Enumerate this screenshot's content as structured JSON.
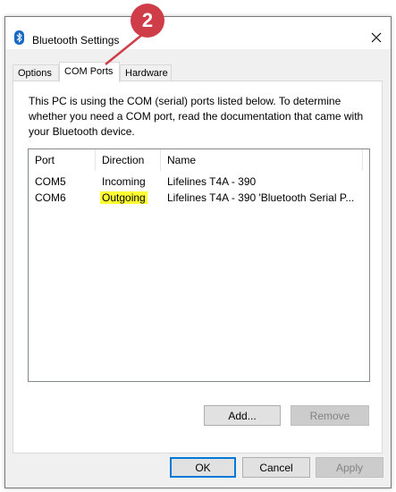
{
  "window": {
    "title": "Bluetooth Settings",
    "icon": "bluetooth-icon",
    "close_icon": "close-icon"
  },
  "tabs": [
    {
      "label": "Options",
      "active": false
    },
    {
      "label": "COM Ports",
      "active": true
    },
    {
      "label": "Hardware",
      "active": false
    }
  ],
  "panel": {
    "description": "This PC is using the COM (serial) ports listed below. To determine whether you need a COM port, read the documentation that came with your Bluetooth device."
  },
  "list": {
    "columns": [
      "Port",
      "Direction",
      "Name"
    ],
    "rows": [
      {
        "port": "COM5",
        "direction": "Incoming",
        "name": "Lifelines T4A - 390",
        "highlight": false
      },
      {
        "port": "COM6",
        "direction": "Outgoing",
        "name": "Lifelines T4A - 390 'Bluetooth Serial P...",
        "highlight": true
      }
    ]
  },
  "buttons": {
    "add": "Add...",
    "remove": "Remove",
    "ok": "OK",
    "cancel": "Cancel",
    "apply": "Apply"
  },
  "callout": {
    "number": "2",
    "color": "#cf3e48"
  },
  "colors": {
    "highlight": "#ffff33",
    "default_button_border": "#0078d7"
  }
}
